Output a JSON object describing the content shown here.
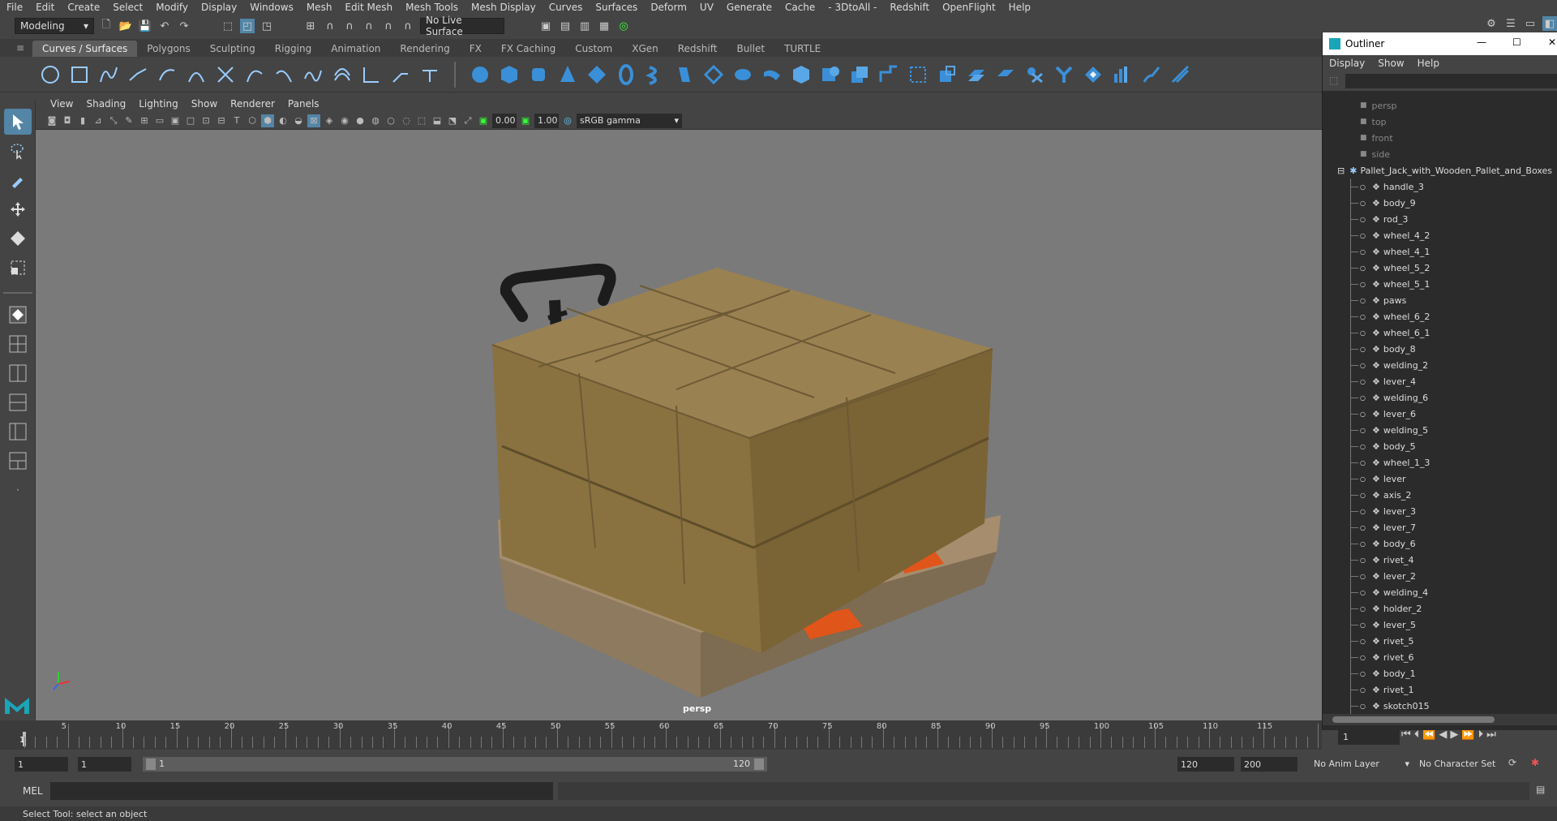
{
  "menubar": [
    "File",
    "Edit",
    "Create",
    "Select",
    "Modify",
    "Display",
    "Windows",
    "Mesh",
    "Edit Mesh",
    "Mesh Tools",
    "Mesh Display",
    "Curves",
    "Surfaces",
    "Deform",
    "UV",
    "Generate",
    "Cache",
    "- 3DtoAll -",
    "Redshift",
    "OpenFlight",
    "Help"
  ],
  "statusline": {
    "mode": "Modeling",
    "live_surface": "No Live Surface"
  },
  "shelf_tabs": [
    "Curves / Surfaces",
    "Polygons",
    "Sculpting",
    "Rigging",
    "Animation",
    "Rendering",
    "FX",
    "FX Caching",
    "Custom",
    "XGen",
    "Redshift",
    "Bullet",
    "TURTLE"
  ],
  "panel_menu": [
    "View",
    "Shading",
    "Lighting",
    "Show",
    "Renderer",
    "Panels"
  ],
  "panel_toolbar": {
    "exposure": "0.00",
    "gamma": "1.00",
    "colorspace": "sRGB gamma"
  },
  "viewport": {
    "camera_label": "persp"
  },
  "timeline": {
    "ticks": [
      "5",
      "10",
      "15",
      "20",
      "25",
      "30",
      "35",
      "40",
      "45",
      "50",
      "55",
      "60",
      "65",
      "70",
      "75",
      "80",
      "85",
      "90",
      "95",
      "100",
      "105",
      "110",
      "115"
    ],
    "current_frame": "1",
    "frame_field": "1"
  },
  "range": {
    "start": "1",
    "playback_start": "1",
    "slider_start": "1",
    "slider_end": "120",
    "playback_end": "120",
    "end": "200",
    "anim_layer": "No Anim Layer",
    "character_set": "No Character Set"
  },
  "mel": {
    "label": "MEL"
  },
  "help_line": "Select Tool: select an object",
  "outliner": {
    "title": "Outliner",
    "menu": [
      "Display",
      "Show",
      "Help"
    ],
    "cameras": [
      "persp",
      "top",
      "front",
      "side"
    ],
    "group": "Pallet_Jack_with_Wooden_Pallet_and_Boxes",
    "items": [
      "handle_3",
      "body_9",
      "rod_3",
      "wheel_4_2",
      "wheel_4_1",
      "wheel_5_2",
      "wheel_5_1",
      "paws",
      "wheel_6_2",
      "wheel_6_1",
      "body_8",
      "welding_2",
      "lever_4",
      "welding_6",
      "lever_6",
      "welding_5",
      "body_5",
      "wheel_1_3",
      "lever",
      "axis_2",
      "lever_3",
      "lever_7",
      "body_6",
      "rivet_4",
      "lever_2",
      "welding_4",
      "holder_2",
      "lever_5",
      "rivet_5",
      "rivet_6",
      "body_1",
      "rivet_1",
      "skotch015"
    ]
  },
  "colors": {
    "accent": "#5285a6",
    "panel": "#444444",
    "viewport": "#7a7a7a",
    "box": "#8a7240",
    "handle_orange": "#e0551a"
  }
}
